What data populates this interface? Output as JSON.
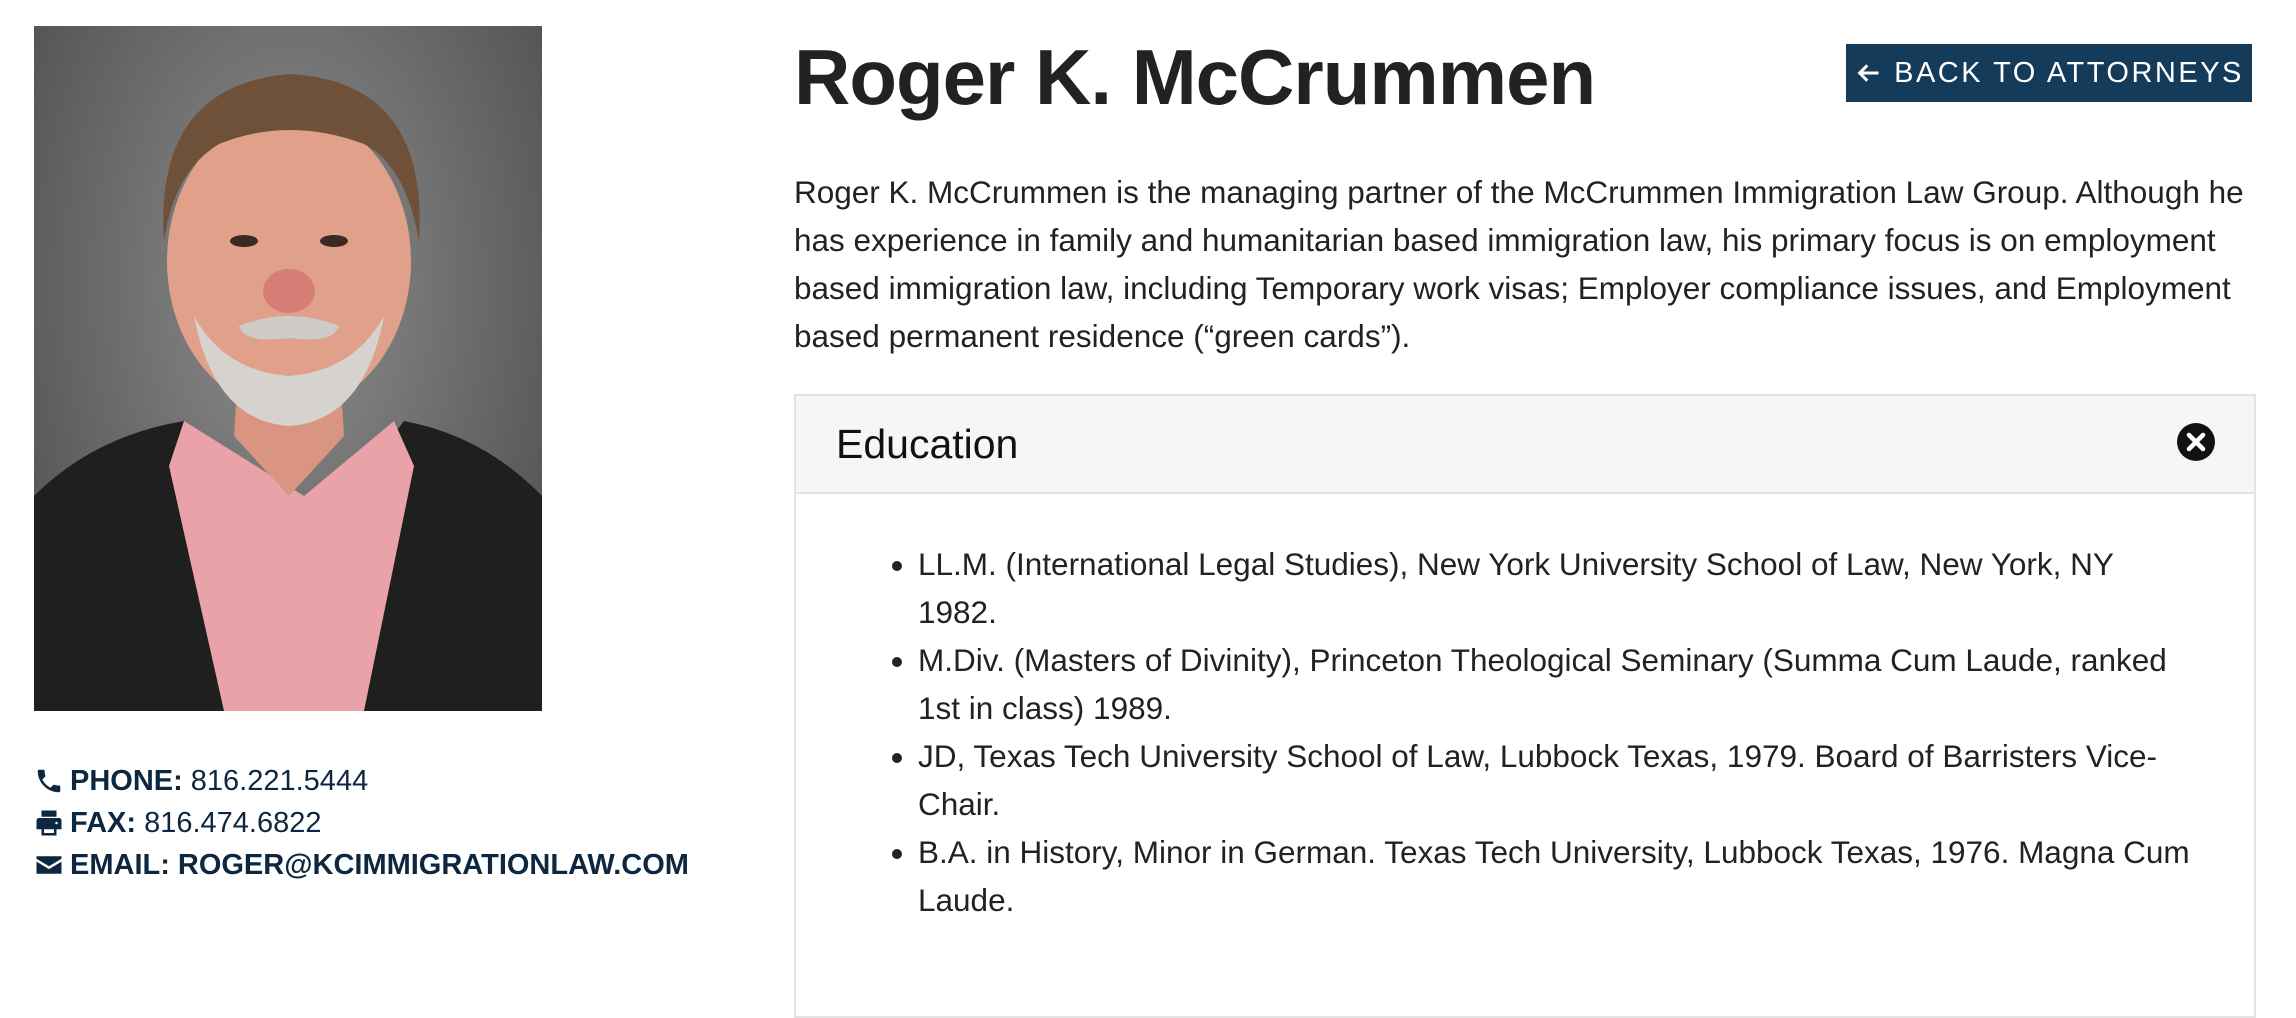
{
  "attorney": {
    "name": "Roger K. McCrummen",
    "bio": "Roger K. McCrummen is the managing partner of the McCrummen Immigration Law Group. Although he has experience in family and humanitarian based immigration law, his primary focus is on employment based immigration law, including Temporary work visas; Employer compliance issues, and Employment based permanent residence (“green cards”)."
  },
  "nav": {
    "back_label": "BACK TO ATTORNEYS",
    "back_icon": "arrow-left-icon"
  },
  "contact": {
    "phone_label": "PHONE:",
    "phone": "816.221.5444",
    "phone_icon": "phone-icon",
    "fax_label": "FAX:",
    "fax": "816.474.6822",
    "fax_icon": "printer-icon",
    "email_label": "EMAIL:",
    "email": "ROGER@KCIMMIGRATIONLAW.COM",
    "email_icon": "envelope-icon"
  },
  "education": {
    "title": "Education",
    "toggle_icon": "close-circle-icon",
    "items": [
      "LL.M. (International Legal Studies), New York University School of Law, New York, NY 1982.",
      "M.Div. (Masters of Divinity), Princeton Theological Seminary (Summa Cum Laude, ranked 1st in class) 1989.",
      "JD, Texas Tech University School of Law, Lubbock Texas, 1979. Board of Barristers Vice-Chair.",
      "B.A. in History, Minor in German. Texas Tech University, Lubbock Texas, 1976. Magna Cum Laude."
    ]
  },
  "colors": {
    "brand": "#153b5b",
    "contact_text": "#0e2740",
    "panel_header": "#f6f6f6",
    "border": "#e3e3e3"
  }
}
